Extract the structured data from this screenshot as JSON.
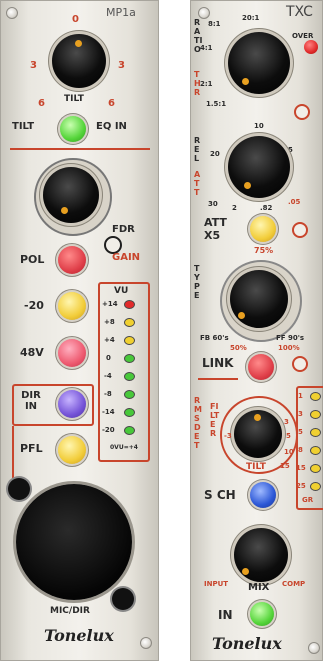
{
  "mp1a": {
    "model": "MP1a",
    "tilt_scale": {
      "top": "0",
      "left": "3",
      "right": "3",
      "bottom_left": "6",
      "bottom_right": "6"
    },
    "tilt_label": "TILT",
    "tilt_button_label": "TILT",
    "eq_in_label": "EQ IN",
    "fdr_label": "FDR",
    "gain_label": "GAIN",
    "pol_label": "POL",
    "pad_label": "-20",
    "phantom_label": "48V",
    "dir_in_label": "DIR IN",
    "pfl_label": "PFL",
    "vu_label": "VU",
    "vu_scale": [
      "+14",
      "+8",
      "+4",
      "0",
      "-4",
      "-8",
      "-14",
      "-20"
    ],
    "vu_footer": "0VU=+4",
    "mic_dir_label": "MIC/DIR",
    "brand": "Tonelux",
    "colors": {
      "accent_red": "#c8452c",
      "pol": "#e0404a",
      "pad": "#f2cd3a",
      "phantom": "#ee5a70",
      "eq_in": "#55d53a",
      "dir_in": "#7654d8",
      "pfl": "#f2cd3a"
    }
  },
  "txc": {
    "model": "TXC",
    "ratio_label": "RATIO",
    "thr_label": "THR",
    "ratio_scale": [
      "8:1",
      "20:1",
      "4:1",
      "2:1",
      "1.5:1",
      "OVER"
    ],
    "rel_label": "REL",
    "att_label": "ATT",
    "att_scale": [
      "30",
      "20",
      "10",
      "5",
      "2",
      ".82",
      ".05"
    ],
    "att_x5_label": "ATT X5",
    "type_label": "TYPE",
    "type_pct": "75%",
    "type_scale": [
      "FB 60's",
      "FF 90's",
      "50%",
      "100%"
    ],
    "link_label": "LINK",
    "rms_det_label": "RMS DET",
    "filter_label": "FILTER",
    "filter_tilt_label": "TILT",
    "filter_scale": [
      "-3",
      "3",
      "5",
      "10",
      "15"
    ],
    "sch_label": "S CH",
    "mix_label": "MIX",
    "mix_left": "INPUT",
    "mix_right": "COMP",
    "in_label": "IN",
    "gr_scale": [
      "1",
      "3",
      "5",
      "8",
      "15",
      "25"
    ],
    "gr_label": "GR",
    "brand": "Tonelux",
    "colors": {
      "accent_red": "#c8452c",
      "att_x5": "#f2cd3a",
      "link": "#e0404a",
      "sch": "#2c57d6",
      "in": "#55d53a",
      "over_led": "#e02a2a"
    }
  }
}
